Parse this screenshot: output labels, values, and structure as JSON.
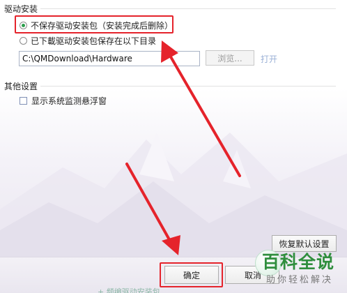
{
  "driver_install": {
    "section_title": "驱动安装",
    "option_no_keep": "不保存驱动安装包（安装完成后删除）",
    "option_keep": "已下載驱动安装包保存在以下目录",
    "path_value": "C:\\QMDownload\\Hardware",
    "browse_label": "浏览...",
    "open_label": "打开"
  },
  "other_settings": {
    "section_title": "其他设置",
    "show_monitor_label": "显示系统监测悬浮窗"
  },
  "buttons": {
    "restore_defaults": "恢复默认设置",
    "ok": "确定",
    "cancel": "取消"
  },
  "watermark": {
    "main": "百科全说",
    "sub": "助你轻松解决"
  },
  "footer_text": "+ 频编驱动安装包",
  "colors": {
    "annotation_red": "#e5232b",
    "radio_green": "#2a9d4b",
    "link_disabled": "#9ab0d6",
    "watermark_green": "#2f8e3d"
  },
  "icons": [
    "radio-selected-icon",
    "radio-empty-icon",
    "checkbox-icon",
    "annotation-arrow-icon",
    "baike-logo-icon"
  ]
}
